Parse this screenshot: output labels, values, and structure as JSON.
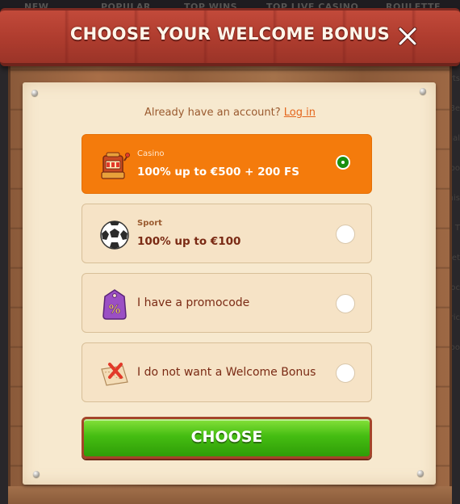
{
  "background": {
    "nav_items": [
      "NEW",
      "POPULAR",
      "TOP WINS",
      "TOP LIVE CASINO",
      "ROULETTE"
    ],
    "side_items": [
      "orts",
      "Be",
      "ual",
      "zbo",
      "nis",
      "e T",
      "et",
      "loc",
      "eric",
      "zebo"
    ]
  },
  "modal": {
    "title": "CHOOSE YOUR WELCOME BONUS",
    "close_icon": "close-swords-icon",
    "login_prompt": "Already have an account?",
    "login_link": "Log in",
    "options": [
      {
        "category": "Casino",
        "label": "100% up to €500 + 200 FS",
        "icon": "slot-machine-icon",
        "selected": true
      },
      {
        "category": "Sport",
        "label": "100% up to €100",
        "icon": "soccer-ball-icon",
        "selected": false
      },
      {
        "label": "I have a promocode",
        "icon": "percent-tag-icon",
        "selected": false
      },
      {
        "label": "I do not want a Welcome Bonus",
        "icon": "crossed-map-icon",
        "selected": false
      }
    ],
    "choose_button": "CHOOSE",
    "colors": {
      "selected_option": "#f47b0c",
      "option_bg": "#f6e3c6",
      "choose_green": "#45bd12",
      "header_red": "#b03d2f",
      "link_orange": "#e4661d"
    }
  }
}
